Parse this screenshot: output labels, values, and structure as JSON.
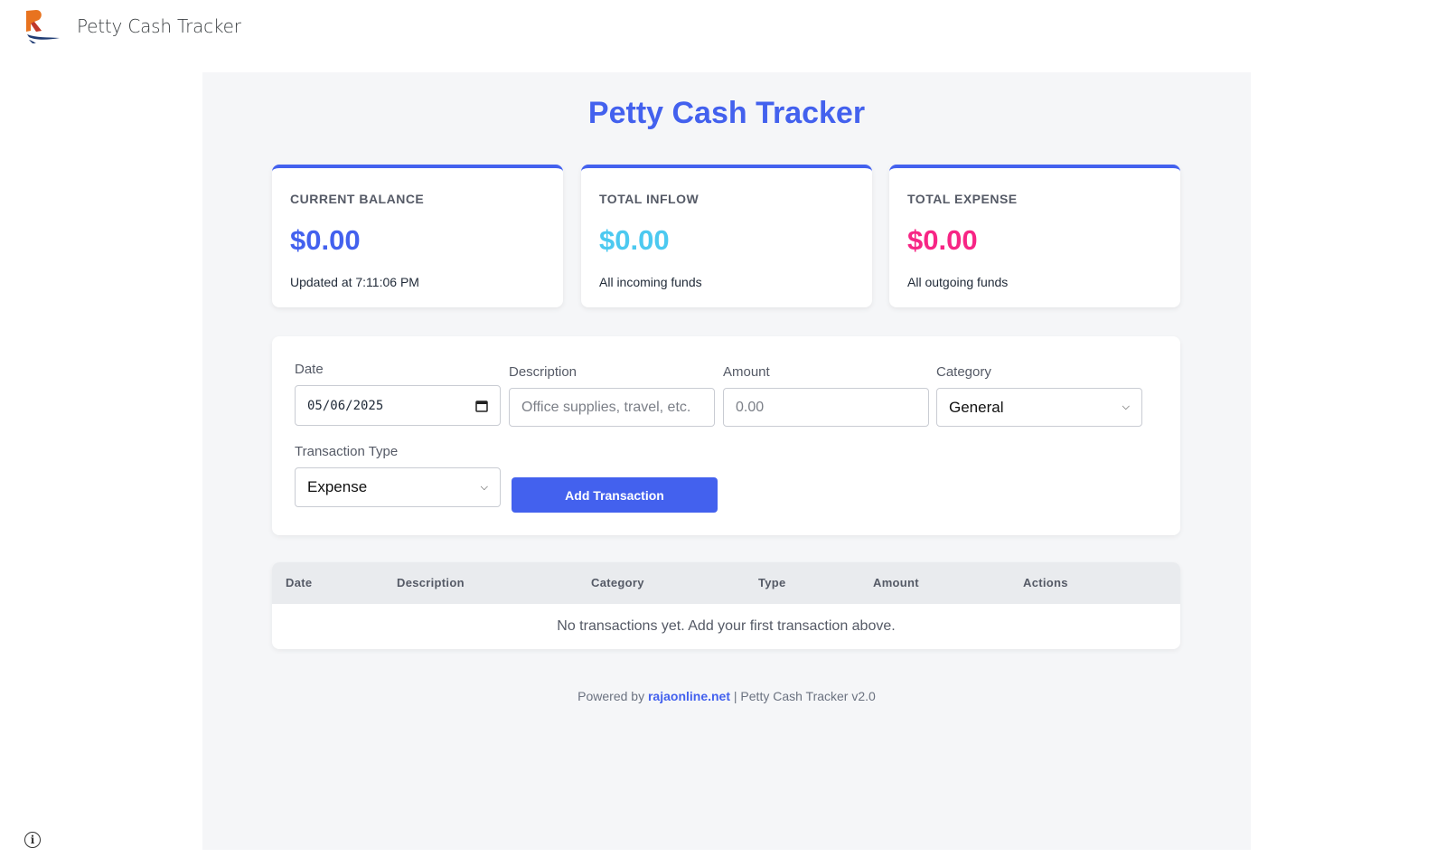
{
  "header": {
    "site_title": "Petty Cash Tracker"
  },
  "app": {
    "title": "Petty Cash Tracker"
  },
  "colors": {
    "accent": "#4361ee",
    "inflow": "#4cc9f0",
    "expense": "#f72585"
  },
  "cards": [
    {
      "label": "CURRENT BALANCE",
      "value": "$0.00",
      "sub": "Updated at 7:11:06 PM",
      "color": "#4361ee"
    },
    {
      "label": "TOTAL INFLOW",
      "value": "$0.00",
      "sub": "All incoming funds",
      "color": "#4cc9f0"
    },
    {
      "label": "TOTAL EXPENSE",
      "value": "$0.00",
      "sub": "All outgoing funds",
      "color": "#f72585"
    }
  ],
  "form": {
    "date_label": "Date",
    "date_value": "05/06/2025",
    "description_label": "Description",
    "description_placeholder": "Office supplies, travel, etc.",
    "amount_label": "Amount",
    "amount_placeholder": "0.00",
    "category_label": "Category",
    "category_value": "General",
    "type_label": "Transaction Type",
    "type_value": "Expense",
    "submit_label": "Add Transaction"
  },
  "table": {
    "headers": [
      "Date",
      "Description",
      "Category",
      "Type",
      "Amount",
      "Actions"
    ],
    "empty_message": "No transactions yet. Add your first transaction above."
  },
  "footer": {
    "prefix": "Powered by",
    "link": "rajaonline.net",
    "suffix": "| Petty Cash Tracker v2.0"
  },
  "icons": {
    "logo": "brand-logo",
    "info": "info-icon",
    "calendar": "calendar-icon"
  }
}
